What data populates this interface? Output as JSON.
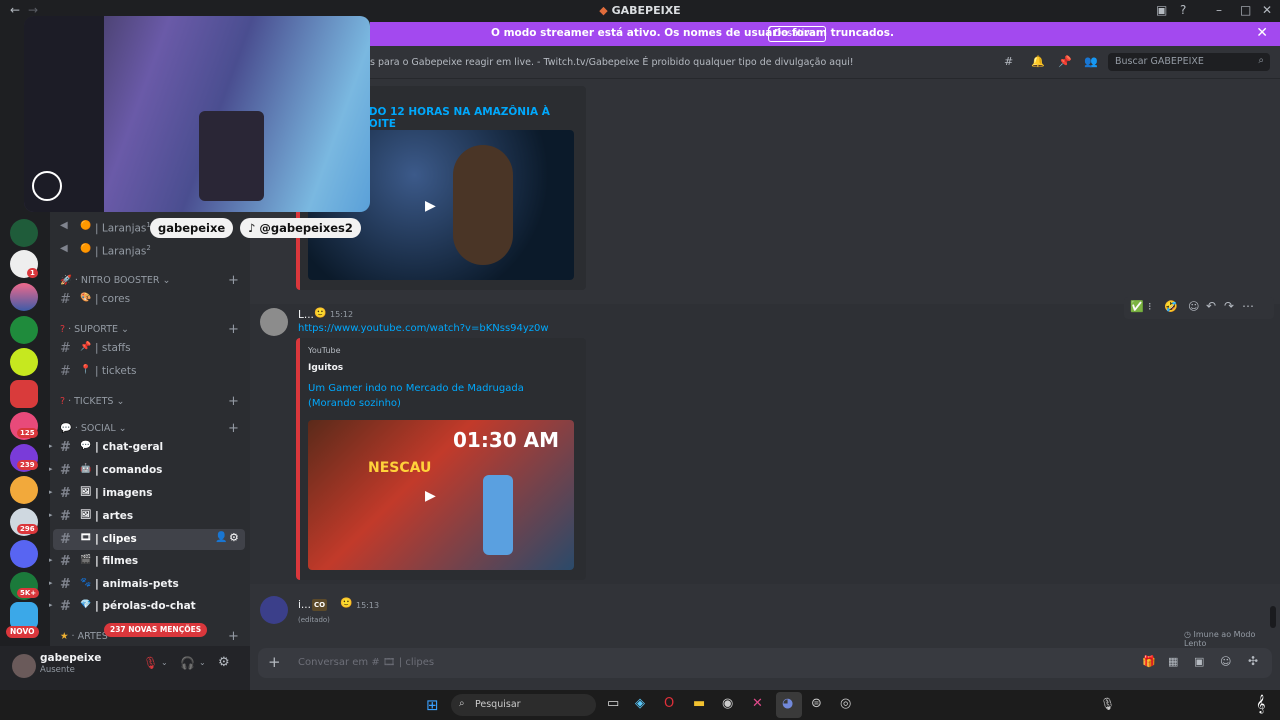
{
  "window": {
    "title": "GABEPEIXE"
  },
  "banner": {
    "text": "O modo streamer está ativo. Os nomes de usuário foram truncados.",
    "button": "Desativar"
  },
  "header": {
    "topic": "s para o Gabepeixe reagir em live. - Twitch.tv/Gabepeixe É proibido qualquer tipo de divulgação aqui!",
    "search_placeholder": "Buscar GABEPEIXE"
  },
  "sidebar": {
    "voice_channels": [
      {
        "label": "| Laranjas",
        "sup": "1"
      },
      {
        "label": "| Laranjas",
        "sup": "2"
      }
    ],
    "categories": {
      "nitro": "NITRO BOOSTER",
      "suporte": "SUPORTE",
      "tickets": "TICKETS",
      "social": "SOCIAL",
      "artes": "ARTES"
    },
    "nitro_channels": [
      "| cores"
    ],
    "suporte_channels": [
      "| staffs",
      "| tickets"
    ],
    "social_channels": [
      "| chat-geral",
      "| comandos",
      "| imagens",
      "| artes",
      "| clipes",
      "| filmes",
      "| animais-pets",
      "| pérolas-do-chat"
    ],
    "mentions_badge": "237 NOVAS MENÇÕES",
    "new_badge": "NOVO"
  },
  "server_badges": [
    "1",
    "125",
    "239",
    "296",
    "5K+"
  ],
  "user": {
    "name": "gabepeixe",
    "status": "Ausente"
  },
  "overlay": {
    "handle1": "gabepeixe",
    "handle2": "@gabepeixes2"
  },
  "messages": [
    {
      "embed_title": "NDO 12 HORAS NA AMAZÔNIA À NOITE"
    },
    {
      "author": "L...",
      "time": "15:12",
      "url": "https://www.youtube.com/watch?v=bKNss94yz0w",
      "provider": "YouTube",
      "embed_author": "Iguitos",
      "embed_title": "Um Gamer indo no Mercado de Madrugada (Morando sozinho)",
      "thumb_text": "01:30 AM",
      "thumb_brand": "NESCAU"
    },
    {
      "author": "i...",
      "tag": "CO",
      "time": "15:13",
      "edited": "(editado)"
    }
  ],
  "slow_mode": "Imune ao Modo Lento",
  "composer": {
    "placeholder": "Conversar em #",
    "channel": "| clipes"
  },
  "taskbar": {
    "search_placeholder": "Pesquisar"
  },
  "colors": {
    "banner": "#a349ef",
    "link": "#00a8fc",
    "embed_border": "#da373c",
    "mention": "#da373c"
  }
}
